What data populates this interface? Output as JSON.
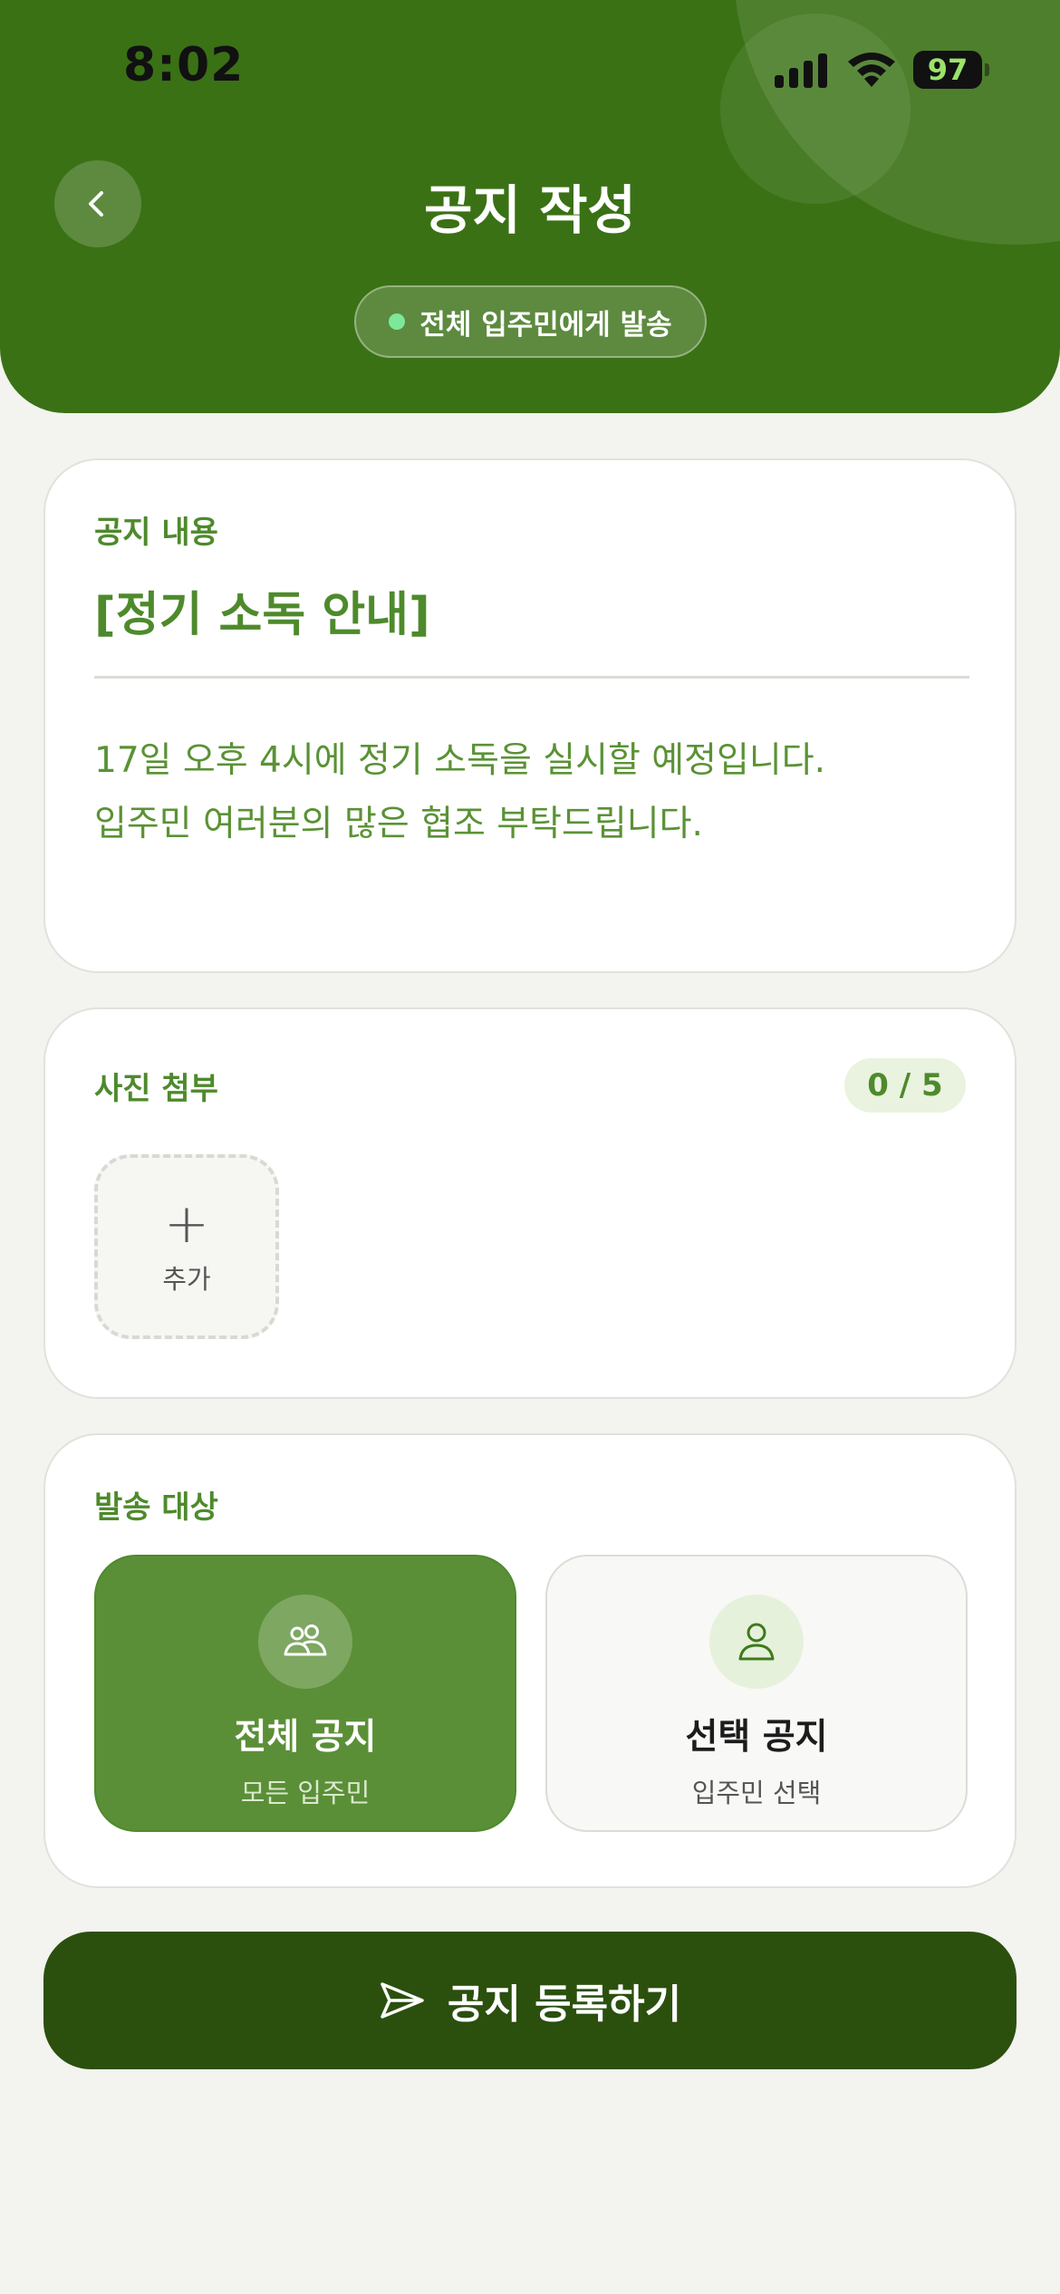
{
  "status_bar": {
    "time": "8:02",
    "battery": "97"
  },
  "header": {
    "title": "공지 작성",
    "audience_pill": "전체 입주민에게 발송"
  },
  "notice": {
    "section_label": "공지 내용",
    "title": "[정기 소독 안내]",
    "body_lines": [
      "17일 오후 4시에 정기 소독을 실시할 예정입니다.",
      "입주민 여러분의 많은 협조 부탁드립니다."
    ]
  },
  "photos": {
    "section_label": "사진 첨부",
    "counter": "0 / 5",
    "add_label": "추가"
  },
  "target": {
    "section_label": "발송 대상",
    "options": [
      {
        "title": "전체 공지",
        "subtitle": "모든 입주민",
        "selected": true,
        "icon": "users-icon"
      },
      {
        "title": "선택 공지",
        "subtitle": "입주민 선택",
        "selected": false,
        "icon": "user-icon"
      }
    ]
  },
  "submit": {
    "label": "공지 등록하기",
    "icon": "send-icon"
  },
  "colors": {
    "brand_green": "#3a7115",
    "dark_green": "#2b500e",
    "accent_text": "#4e8a2c",
    "selected_card": "#5a8f37"
  }
}
